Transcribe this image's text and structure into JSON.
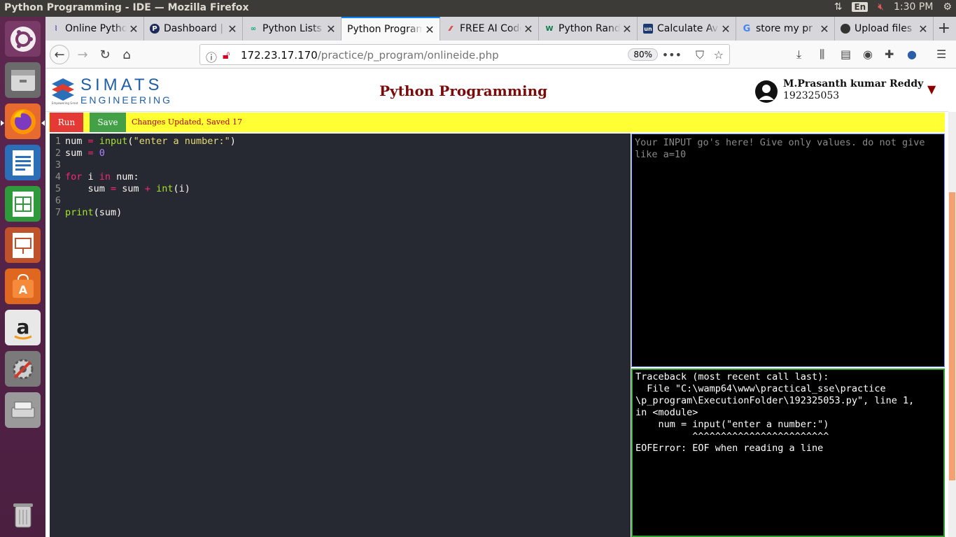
{
  "system": {
    "window_title": "Python Programming - IDE — Mozilla Firefox",
    "keyboard_layout": "En",
    "time": "1:30 PM"
  },
  "launcher": {
    "items": [
      "ubuntu-dash",
      "files",
      "firefox",
      "writer",
      "calc",
      "impress",
      "software-center",
      "amazon",
      "system-settings",
      "scanner",
      "trash"
    ]
  },
  "browser": {
    "tabs": [
      {
        "label": "Online Python",
        "favicon": "python"
      },
      {
        "label": "Dashboard | P",
        "favicon": "p-circle"
      },
      {
        "label": "Python Lists",
        "favicon": "infinity"
      },
      {
        "label": "Python Programming",
        "favicon": "none",
        "active": true
      },
      {
        "label": "FREE AI Code",
        "favicon": "ai"
      },
      {
        "label": "Python Rand",
        "favicon": "w"
      },
      {
        "label": "Calculate Av",
        "favicon": "un"
      },
      {
        "label": "store my pr",
        "favicon": "google"
      },
      {
        "label": "Upload files",
        "favicon": "github"
      }
    ],
    "url_host": "172.23.17.170",
    "url_path": "/practice/p_program/onlineide.php",
    "zoom": "80%"
  },
  "page": {
    "logo_name": "SIMATS",
    "logo_sub": "ENGINEERING",
    "logo_tagline": "Empowering Great",
    "title": "Python Programming",
    "user_name": "M.Prasanth kumar Reddy",
    "user_id": "192325053",
    "run_label": "Run",
    "save_label": "Save",
    "status": "Changes Updated, Saved 17",
    "code_lines": [
      "1",
      "2",
      "3",
      "4",
      "5",
      "6",
      "7"
    ],
    "code": {
      "l1_a": "num",
      "l1_b": " = ",
      "l1_c": "input",
      "l1_d": "(",
      "l1_e": "\"enter a number:\"",
      "l1_f": ")",
      "l2_a": "sum",
      "l2_b": " = ",
      "l2_c": "0",
      "l4_a": "for",
      "l4_b": " i ",
      "l4_c": "in",
      "l4_d": " num:",
      "l5_a": "    sum ",
      "l5_b": "=",
      "l5_c": " sum ",
      "l5_d": "+",
      "l5_e": " ",
      "l5_f": "int",
      "l5_g": "(i)",
      "l7_a": "print",
      "l7_b": "(sum)"
    },
    "input_placeholder": "Your INPUT go's here! Give only values. do not give like a=10",
    "output": "Traceback (most recent call last):\n  File \"C:\\wamp64\\www\\practical_sse\\practice\n\\p_program\\ExecutionFolder\\192325053.py\", line 1,\nin <module>\n    num = input(\"enter a number:\")\n          ^^^^^^^^^^^^^^^^^^^^^^^^\nEOFError: EOF when reading a line"
  },
  "colors": {
    "launcher": "#5e2750",
    "run": "#e53935",
    "save": "#43a047",
    "toolbar": "#ffff33",
    "title": "#7b0a0a",
    "editor_bg": "#262932"
  }
}
